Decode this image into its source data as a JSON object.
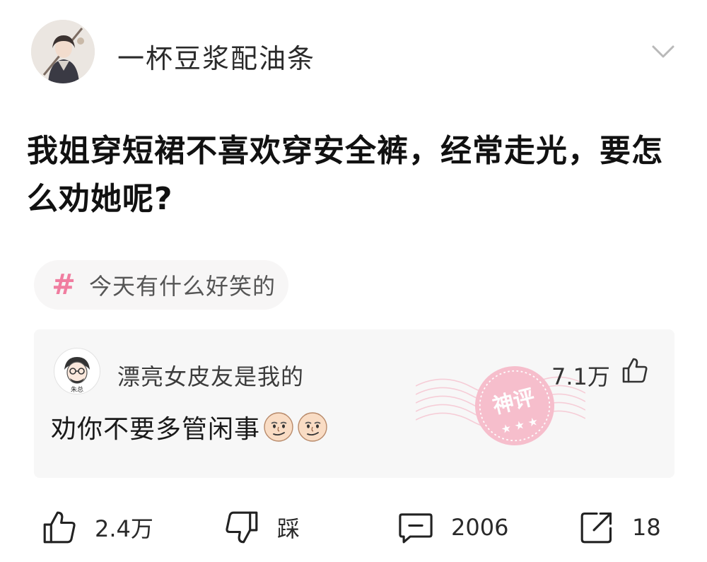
{
  "post": {
    "author": {
      "name": "一杯豆浆配油条",
      "avatar_icon": "user-avatar"
    },
    "collapse_icon": "chevron-down-icon",
    "title": "我姐穿短裙不喜欢穿安全裤，经常走光，要怎么劝她呢?",
    "topic": {
      "icon": "hashtag-icon",
      "label": "今天有什么好笑的",
      "color": "#f07da0"
    }
  },
  "top_comment": {
    "author": "漂亮女皮友是我的",
    "avatar_caption": "朱总",
    "likes": "7.1万",
    "text": "劝你不要多管闲事",
    "emojis": [
      "smirk-face-emoji",
      "smirk-face-emoji"
    ],
    "badge": {
      "label": "神评",
      "color": "#f28aa3"
    }
  },
  "actions": {
    "like": {
      "icon": "thumb-up-icon",
      "count": "2.4万"
    },
    "dislike": {
      "icon": "thumb-down-icon",
      "label": "踩"
    },
    "comment": {
      "icon": "comment-icon",
      "count": "2006"
    },
    "share": {
      "icon": "share-icon",
      "count": "18"
    }
  }
}
